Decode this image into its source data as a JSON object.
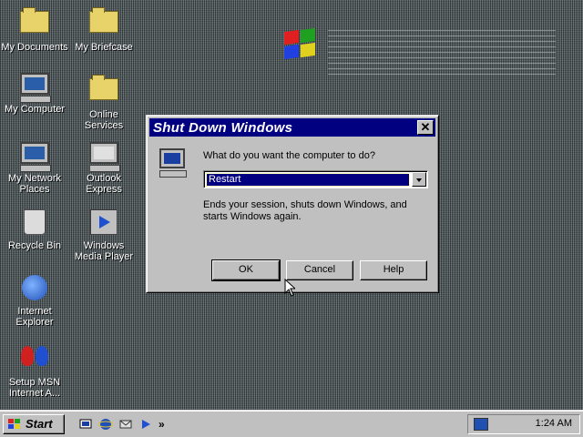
{
  "desktop": {
    "icons": [
      {
        "label": "My Documents"
      },
      {
        "label": "My Briefcase"
      },
      {
        "label": "My Computer"
      },
      {
        "label": "Online Services"
      },
      {
        "label": "My Network Places"
      },
      {
        "label": "Outlook Express"
      },
      {
        "label": "Recycle Bin"
      },
      {
        "label": "Windows Media Player"
      },
      {
        "label": "Internet Explorer"
      },
      {
        "label": "Setup MSN Internet A..."
      }
    ]
  },
  "dialog": {
    "title": "Shut Down Windows",
    "close_glyph": "✕",
    "prompt": "What do you want the computer to do?",
    "selected_option": "Restart",
    "description": "Ends your session, shuts down Windows, and starts Windows again.",
    "buttons": {
      "ok": "OK",
      "cancel": "Cancel",
      "help": "Help"
    },
    "icon": "computer-icon"
  },
  "taskbar": {
    "start_label": "Start",
    "clock": "1:24 AM",
    "quick_launch": [
      "show-desktop-icon",
      "ie-icon",
      "outlook-icon",
      "media-player-icon"
    ],
    "overflow_glyph": "»"
  },
  "colors": {
    "title_bar": "#000080",
    "face": "#c0c0c0",
    "selection": "#000080"
  }
}
